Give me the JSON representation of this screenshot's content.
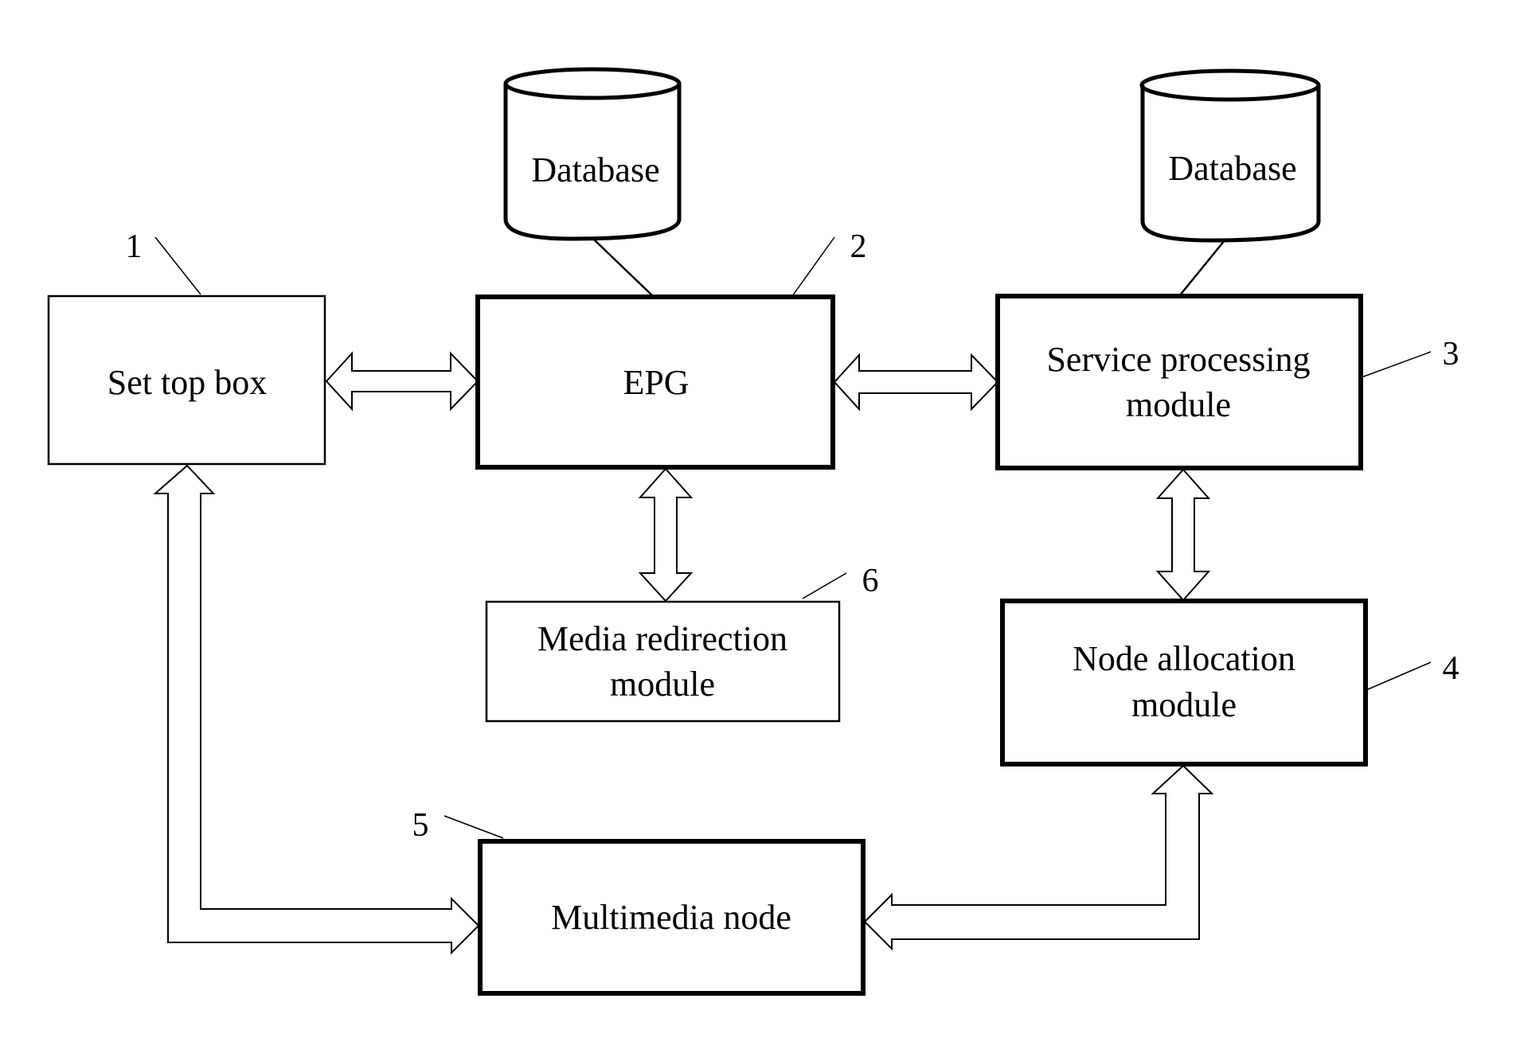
{
  "diagram": {
    "nodes": {
      "set_top_box": {
        "label": "Set top box",
        "ref": "1"
      },
      "epg": {
        "label": "EPG",
        "ref": "2"
      },
      "service_processing": {
        "line1": "Service processing",
        "line2": "module",
        "ref": "3"
      },
      "node_allocation": {
        "line1": "Node allocation",
        "line2": "module",
        "ref": "4"
      },
      "multimedia_node": {
        "label": "Multimedia node",
        "ref": "5"
      },
      "media_redirection": {
        "line1": "Media redirection",
        "line2": "module",
        "ref": "6"
      },
      "database_epg": {
        "label": "Database"
      },
      "database_service": {
        "label": "Database"
      }
    },
    "connections": [
      {
        "from": "set_top_box",
        "to": "epg",
        "type": "bidirectional"
      },
      {
        "from": "epg",
        "to": "service_processing",
        "type": "bidirectional"
      },
      {
        "from": "epg",
        "to": "media_redirection",
        "type": "bidirectional"
      },
      {
        "from": "service_processing",
        "to": "node_allocation",
        "type": "bidirectional"
      },
      {
        "from": "set_top_box",
        "to": "multimedia_node",
        "type": "bidirectional"
      },
      {
        "from": "node_allocation",
        "to": "multimedia_node",
        "type": "bidirectional"
      },
      {
        "from": "database_epg",
        "to": "epg",
        "type": "line"
      },
      {
        "from": "database_service",
        "to": "service_processing",
        "type": "line"
      }
    ]
  }
}
